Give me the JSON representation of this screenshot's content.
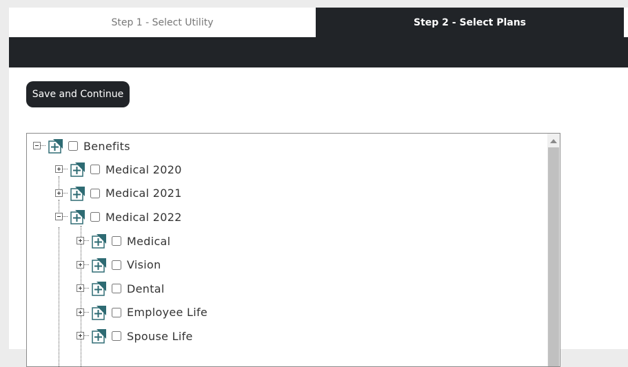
{
  "steps": [
    {
      "label": "Step 1 - Select Utility",
      "active": false
    },
    {
      "label": "Step 2 - Select Plans",
      "active": true
    }
  ],
  "actions": {
    "save_label": "Save and Continue"
  },
  "tree": {
    "root": {
      "label": "Benefits",
      "expanded": true,
      "checked": false
    },
    "years": [
      {
        "label": "Medical 2020",
        "expanded": false,
        "checked": false
      },
      {
        "label": "Medical 2021",
        "expanded": false,
        "checked": false
      },
      {
        "label": "Medical 2022",
        "expanded": true,
        "checked": false
      }
    ],
    "plans": [
      {
        "label": "Medical",
        "expanded": false,
        "checked": false
      },
      {
        "label": "Vision",
        "expanded": false,
        "checked": false
      },
      {
        "label": "Dental",
        "expanded": false,
        "checked": false
      },
      {
        "label": "Employee Life",
        "expanded": false,
        "checked": false
      },
      {
        "label": "Spouse Life",
        "expanded": false,
        "checked": false
      }
    ]
  },
  "colors": {
    "dark": "#212428",
    "icon_teal": "#2e6b73"
  }
}
